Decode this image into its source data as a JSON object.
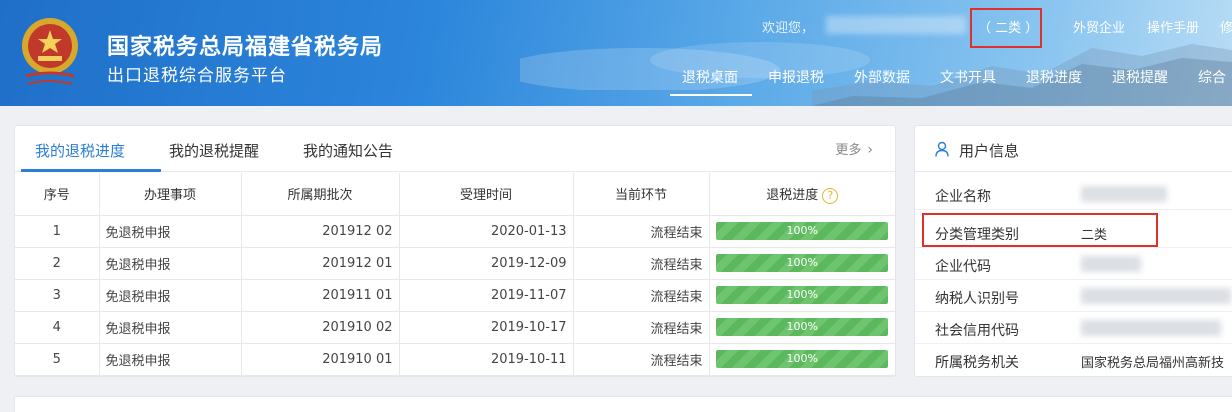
{
  "header": {
    "title": "国家税务总局福建省税务局",
    "subtitle": "出口退税综合服务平台",
    "welcome": "欢迎您，",
    "category_text": "（ 二类 ）",
    "links": [
      "外贸企业",
      "操作手册",
      "修"
    ],
    "nav": [
      "退税桌面",
      "申报退税",
      "外部数据",
      "文书开具",
      "退税进度",
      "退税提醒",
      "综合"
    ],
    "active_nav": "退税桌面"
  },
  "tabs": {
    "items": [
      "我的退税进度",
      "我的退税提醒",
      "我的通知公告"
    ],
    "active": "我的退税进度",
    "more": "更多"
  },
  "table": {
    "headers": [
      "序号",
      "办理事项",
      "所属期批次",
      "受理时间",
      "当前环节",
      "退税进度"
    ],
    "rows": [
      {
        "no": "1",
        "item": "免退税申报",
        "batch": "201912 02",
        "time": "2020-01-13",
        "stage": "流程结束",
        "progress": "100%"
      },
      {
        "no": "2",
        "item": "免退税申报",
        "batch": "201912 01",
        "time": "2019-12-09",
        "stage": "流程结束",
        "progress": "100%"
      },
      {
        "no": "3",
        "item": "免退税申报",
        "batch": "201911 01",
        "time": "2019-11-07",
        "stage": "流程结束",
        "progress": "100%"
      },
      {
        "no": "4",
        "item": "免退税申报",
        "batch": "201910 02",
        "time": "2019-10-17",
        "stage": "流程结束",
        "progress": "100%"
      },
      {
        "no": "5",
        "item": "免退税申报",
        "batch": "201910 01",
        "time": "2019-10-11",
        "stage": "流程结束",
        "progress": "100%"
      }
    ]
  },
  "user_info": {
    "title": "用户信息",
    "rows": [
      {
        "label": "企业名称",
        "value": ""
      },
      {
        "label": "分类管理类别",
        "value": "二类"
      },
      {
        "label": "企业代码",
        "value": ""
      },
      {
        "label": "纳税人识别号",
        "value": ""
      },
      {
        "label": "社会信用代码",
        "value": ""
      },
      {
        "label": "所属税务机关",
        "value": "国家税务总局福州高新技"
      }
    ]
  },
  "colors": {
    "accent": "#2b7fd6",
    "progress": "#5cb85c",
    "highlight": "#e0302a"
  }
}
